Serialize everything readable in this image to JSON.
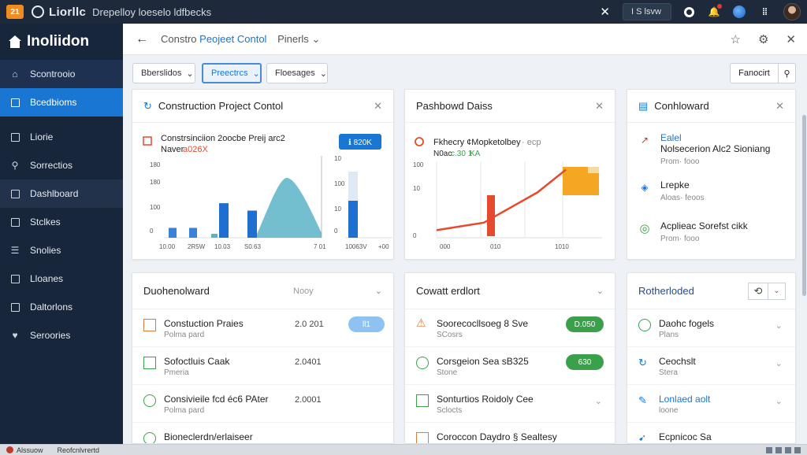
{
  "topbar": {
    "badge": "21",
    "brand": "Liorllc",
    "title": "Drepelloy loeselo ldfbecks",
    "close": "✕",
    "search_chip": "I S lsvw"
  },
  "sidebar": {
    "brand": "Inoliidon",
    "items": [
      {
        "label": "Scontrooio",
        "icon": "home-icon"
      },
      {
        "label": "Bcedbioms",
        "icon": "briefcase-icon"
      },
      {
        "label": "Liorie",
        "icon": "file-icon"
      },
      {
        "label": "Sorrectios",
        "icon": "user-icon"
      },
      {
        "label": "Dashlboard",
        "icon": "dashboard-icon"
      },
      {
        "label": "Stclkes",
        "icon": "stack-icon"
      },
      {
        "label": "Snolies",
        "icon": "list-icon"
      },
      {
        "label": "Lloanes",
        "icon": "calendar-icon"
      },
      {
        "label": "Daltorlons",
        "icon": "folder-icon"
      },
      {
        "label": "Seroories",
        "icon": "heart-icon"
      }
    ]
  },
  "header": {
    "crumb_prefix": "Constro",
    "crumb_current": "Peojeet Contol",
    "crumb_sub": "Pinerls",
    "crumb_chevron": "⌄"
  },
  "filters": {
    "f1": "Bberslidos",
    "f2": "Preectrcs",
    "f3": "Floesages",
    "search": "Fanocirt"
  },
  "card1": {
    "title": "Construction Project Contol",
    "subtitle": "Constrsinciion 2oocbe Preij arc2",
    "subtitle2": "Naver",
    "subtitle2_accent": "a026X",
    "button": "ℹ 820K",
    "left_ticks": [
      "180",
      "180",
      "100",
      "0"
    ],
    "left_x": [
      "10.00",
      "2R5W",
      "10.03",
      "S0.63",
      "7 01"
    ],
    "right_ticks": [
      "10",
      "100",
      "10",
      "0"
    ],
    "right_x": [
      "10063V",
      "+00"
    ]
  },
  "card2": {
    "title": "Pashbowd Daiss",
    "subtitle": "Fkhecry ¢Mopketolbey",
    "subtitle_tail": "· ecp",
    "subtitle2_a": "N0ac",
    "subtitle2_b": "c.30 1",
    "subtitle2_c": "KA",
    "ticks": [
      "100",
      "10",
      "0"
    ],
    "x_labels": [
      "000",
      "010",
      "1010",
      "1010"
    ]
  },
  "card3": {
    "title": "Conhloward",
    "items": [
      {
        "title_label": "Ealel",
        "title": "Nolsecerion Alc2 Sioniang",
        "sub": "Prom· fooo"
      },
      {
        "title": "Lrepke",
        "sub": "Aloas· feoos"
      },
      {
        "title": "Acplieac Sorefst cikk",
        "sub": "Prom· fooo"
      }
    ]
  },
  "card4": {
    "title": "Duohenolward",
    "search": "Nooy",
    "rows": [
      {
        "t1": "Constuction Praies",
        "t2": "Polma pard",
        "num": "2.0 201",
        "pill": "ll1",
        "pill_color": "#8ec2f2"
      },
      {
        "t1": "Sofoctluis Caak",
        "t2": "Pmeria",
        "num": "2.0401",
        "pill": ""
      },
      {
        "t1": "Consivieile fcd éc6 PAter",
        "t2": "Polma pard",
        "num": "2.0001",
        "pill": ""
      },
      {
        "t1": "Bioneclerdn/erlaiseer",
        "t2": "",
        "num": "",
        "pill": ""
      }
    ]
  },
  "card5": {
    "title": "Cowatt erdlort",
    "rows": [
      {
        "t1": "Soorecocllsoeg 8 Sve",
        "t2": "SCosrs",
        "pill": "D.050",
        "pill_color": "#3aa14a"
      },
      {
        "t1": "Corsgeion Sea sB325",
        "t2": "Stone",
        "pill": "630",
        "pill_color": "#3aa14a"
      },
      {
        "t1": "Sonturtios Roidoly Cee",
        "t2": "Sclocts",
        "pill": ""
      },
      {
        "t1": "Coroccon Daydro § Sealtesy",
        "t2": "",
        "pill": ""
      }
    ]
  },
  "card6": {
    "title": "Rotherloded",
    "rows": [
      {
        "t1": "Daohc fogels",
        "t2": "Plans"
      },
      {
        "t1": "Ceochslt",
        "t2": "Stera"
      },
      {
        "t1": "Lonlaed aolt",
        "t2": "loone"
      },
      {
        "t1": "Ecpnicoc Sa",
        "t2": ""
      }
    ]
  },
  "taskbar": {
    "a": "Alssuow",
    "b": "Reofcnlvrertd"
  },
  "colors": {
    "accent": "#1976d2",
    "sidebar": "#17263a",
    "orange": "#f5a623",
    "red": "#e64a2e",
    "teal": "#5ab4c8",
    "green": "#3aa14a"
  },
  "chart_data": [
    {
      "type": "bar",
      "categories": [
        "10.00",
        "2R5W",
        "10.03",
        "S0.63",
        "7 01"
      ],
      "series": [
        {
          "values": [
            20,
            20,
            8,
            70,
            55
          ]
        }
      ],
      "note_area": {
        "peak": 100
      },
      "ylim": [
        0,
        150
      ]
    },
    {
      "type": "bar",
      "categories": [
        "10063V"
      ],
      "series": [
        {
          "values": [
            75
          ]
        }
      ],
      "ylim": [
        0,
        150
      ]
    },
    {
      "type": "line",
      "x": [
        "000",
        "010",
        "1010",
        "1010"
      ],
      "series": [
        {
          "values": [
            2,
            4,
            12,
            18
          ]
        }
      ],
      "ylim": [
        0,
        20
      ]
    }
  ]
}
